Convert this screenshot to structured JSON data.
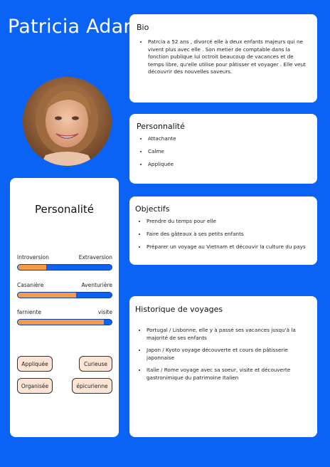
{
  "name": "Patricia Adam",
  "bio": {
    "title": "Bio",
    "text": "Patrcia a 52 ans , divorcé elle à deux enfants majeurs qui ne vivent plus avec elle . Son metier de comptable dans la fonction publique lui octroit beaucoup de vacances et de temps libre, qu'elle utilise pour pâtisser et voyager . Elle veut découvrir des nouvelles saveurs."
  },
  "personnalite": {
    "title": "Personnalité",
    "items": [
      "Attachante",
      "Calme",
      "Appliquée"
    ]
  },
  "objectifs": {
    "title": "Objectifs",
    "items": [
      "Prendre du temps pour elle",
      "Faire des gâteaux à ses petits enfants",
      "Préparer un voyage au Vietnam et découvir la culture du pays"
    ]
  },
  "historique": {
    "title": "Historique de voyages",
    "items": [
      "Portugal / Lisbonne, elle y à passé ses vacances jusqu'à la majorité de ses enfants",
      "Japon / Kyoto voyage découverte et cours de pâtisserie japonnaise",
      "Italie / Rome voyage avec sa soeur, visite et découverte gastronimique du patrimoine Italien"
    ]
  },
  "personalite_panel": {
    "title": "Personalité",
    "sliders": [
      {
        "left": "Introversion",
        "right": "Extraversion",
        "value": 0.3
      },
      {
        "left": "Casanière",
        "right": "Aventurière",
        "value": 0.62
      },
      {
        "left": "farniente",
        "right": "visite",
        "value": 0.92
      }
    ],
    "tags": [
      "Appliquée",
      "Curieuse",
      "Organisée",
      "épicurienne"
    ]
  },
  "colors": {
    "background": "#0b63f6",
    "slider_fill": "#f59a4a",
    "tag_bg": "#fde4d4"
  }
}
